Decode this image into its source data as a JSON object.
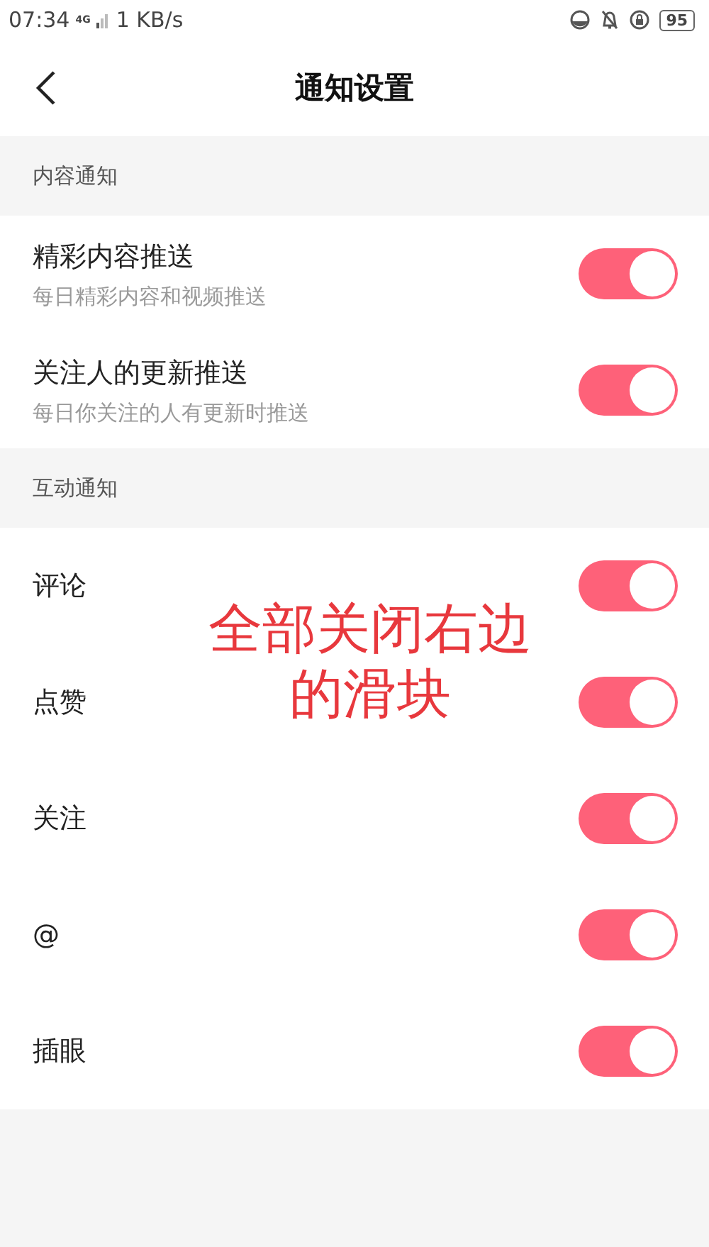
{
  "status_bar": {
    "time": "07:34",
    "network": "4G",
    "speed": "1 KB/s",
    "battery": "95"
  },
  "header": {
    "title": "通知设置"
  },
  "sections": [
    {
      "title": "内容通知",
      "items": [
        {
          "label": "精彩内容推送",
          "description": "每日精彩内容和视频推送",
          "on": true
        },
        {
          "label": "关注人的更新推送",
          "description": "每日你关注的人有更新时推送",
          "on": true
        }
      ]
    },
    {
      "title": "互动通知",
      "items": [
        {
          "label": "评论",
          "on": true
        },
        {
          "label": "点赞",
          "on": true
        },
        {
          "label": "关注",
          "on": true
        },
        {
          "label": "@",
          "on": true
        },
        {
          "label": "插眼",
          "on": true
        }
      ]
    }
  ],
  "annotation": {
    "text": "全部关闭右边的滑块"
  }
}
